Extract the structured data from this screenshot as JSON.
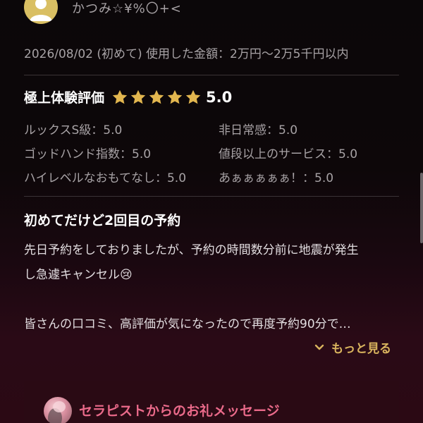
{
  "reviewer": {
    "name": "かつみ☆¥%〇+<"
  },
  "visit": {
    "text": "2026/08/02 (初めて) 使用した金額：2万円〜2万5千円以内"
  },
  "rating": {
    "title": "極上体験評価",
    "score": "5.0",
    "stars": 5,
    "star_color": "#e2b64f",
    "sub_ratings": [
      {
        "text": "ルックスS級：5.0"
      },
      {
        "text": "非日常感：5.0"
      },
      {
        "text": "ゴッドハンド指数：5.0"
      },
      {
        "text": "値段以上のサービス：5.0"
      },
      {
        "text": "ハイレベルなおもてなし：5.0"
      },
      {
        "text": "あぁぁぁぁぁ！：5.0"
      }
    ]
  },
  "review": {
    "title": "初めてだけど2回目の予約",
    "line1": "先日予約をしておりましたが、予約の時間数分前に地震が発生",
    "line2": "し急遽キャンセル😢",
    "line3": "皆さんの口コミ、高評価が気になったので再度予約90分で…",
    "more_label": "もっと見る"
  },
  "thanks": {
    "title": "セラピストからのお礼メッセージ"
  },
  "colors": {
    "accent_gold": "#d9b45e",
    "accent_pink": "#ea6a8a"
  }
}
